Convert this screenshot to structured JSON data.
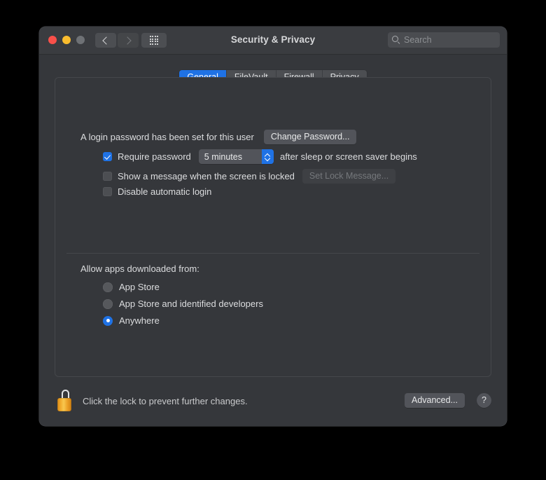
{
  "window": {
    "title": "Security & Privacy",
    "traffic_lights": [
      {
        "name": "close",
        "color": "#f9504a"
      },
      {
        "name": "minimize",
        "color": "#f9bc2e"
      },
      {
        "name": "zoom",
        "color": "#6e7175"
      }
    ],
    "nav": {
      "back_icon": "chevron-left-icon",
      "forward_icon": "chevron-right-icon",
      "grid_icon": "show-all-grid-icon"
    },
    "search": {
      "icon": "search-icon",
      "placeholder": "Search",
      "value": ""
    }
  },
  "tabs": [
    {
      "label": "General",
      "active": true
    },
    {
      "label": "FileVault",
      "active": false
    },
    {
      "label": "Firewall",
      "active": false
    },
    {
      "label": "Privacy",
      "active": false
    }
  ],
  "general": {
    "password_status": "A login password has been set for this user",
    "change_password_button": "Change Password...",
    "require_password": {
      "label": "Require password",
      "checked": true,
      "delay_value": "5 minutes",
      "suffix": "after sleep or screen saver begins"
    },
    "show_message": {
      "label": "Show a message when the screen is locked",
      "checked": false,
      "button": "Set Lock Message...",
      "button_disabled": true
    },
    "disable_automatic_login": {
      "label": "Disable automatic login",
      "checked": false
    },
    "allow_apps": {
      "heading": "Allow apps downloaded from:",
      "options": [
        {
          "label": "App Store",
          "selected": false
        },
        {
          "label": "App Store and identified developers",
          "selected": false
        },
        {
          "label": "Anywhere",
          "selected": true
        }
      ]
    }
  },
  "footer": {
    "lock_icon": "unlocked-padlock-icon",
    "lock_message": "Click the lock to prevent further changes.",
    "advanced_button": "Advanced...",
    "help_button": "?"
  },
  "colors": {
    "accent_blue": "#1f72e5",
    "window_bg": "#35373b",
    "titlebar_bg": "#3a3c40",
    "control_bg": "#52545a",
    "text_primary": "#dcdddf",
    "text_disabled": "#8c8f92",
    "lock_gold": "#f0aa2c"
  }
}
